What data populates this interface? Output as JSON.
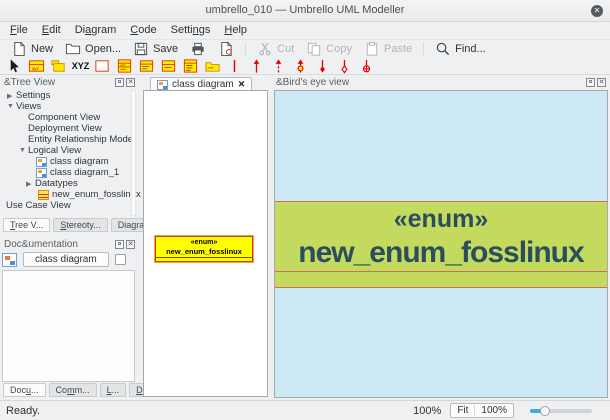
{
  "titlebar": {
    "title": "umbrello_010 — Umbrello UML Modeller"
  },
  "icons": {
    "window_close": "✕",
    "panel_close": "✕",
    "tab_close": "✕",
    "collapsed": "▶",
    "expanded": "▼",
    "object_letters": "xyz"
  },
  "menubar": {
    "items": [
      {
        "pre": "",
        "key": "F",
        "post": "ile"
      },
      {
        "pre": "",
        "key": "E",
        "post": "dit"
      },
      {
        "pre": "Di",
        "key": "a",
        "post": "gram"
      },
      {
        "pre": "",
        "key": "C",
        "post": "ode"
      },
      {
        "pre": "Setti",
        "key": "n",
        "post": "gs"
      },
      {
        "pre": "",
        "key": "H",
        "post": "elp"
      }
    ]
  },
  "toolbar": {
    "new_label": "New",
    "open_label": "Open...",
    "save_label": "Save",
    "cut_label": "Cut",
    "copy_label": "Copy",
    "paste_label": "Paste",
    "find_label": "Find..."
  },
  "work_toolbar": {
    "text_tool_label": "XYZ"
  },
  "tree_panel": {
    "header": "&Tree View",
    "items": [
      {
        "label": "Settings",
        "indent": 5,
        "expander": "collapsed"
      },
      {
        "label": "Views",
        "indent": 5,
        "expander": "expanded"
      },
      {
        "label": "Component View",
        "indent": 26
      },
      {
        "label": "Deployment View",
        "indent": 26
      },
      {
        "label": "Entity Relationship Model",
        "indent": 26
      },
      {
        "label": "Logical View",
        "indent": 17,
        "expander": "expanded"
      },
      {
        "label": "class diagram",
        "indent": 34,
        "icon": "diagram"
      },
      {
        "label": "class diagram_1",
        "indent": 34,
        "icon": "diagram"
      },
      {
        "label": "Datatypes",
        "indent": 24,
        "expander": "collapsed"
      },
      {
        "label": "new_enum_fosslinux",
        "indent": 36,
        "icon": "enum"
      },
      {
        "label": "Use Case View",
        "indent": 4
      }
    ]
  },
  "tree_tabs": {
    "items": [
      {
        "pre": "",
        "key": "T",
        "post": "ree V...",
        "active": true
      },
      {
        "pre": "",
        "key": "S",
        "post": "tereoty...",
        "active": false
      },
      {
        "pre": "Diagra...",
        "key": "",
        "post": "",
        "active": false
      }
    ]
  },
  "doc_panel": {
    "header": "Doc&umentation",
    "button_label": "class diagram"
  },
  "bottom_tabs": {
    "items": [
      {
        "pre": "Doc",
        "key": "u",
        "post": "...",
        "active": true
      },
      {
        "pre": "Co",
        "key": "m",
        "post": "m...",
        "active": false
      },
      {
        "pre": "",
        "key": "L",
        "post": "...",
        "active": false
      },
      {
        "pre": "",
        "key": "D",
        "post": "...",
        "active": false
      }
    ]
  },
  "diagram_tab": {
    "label": "class diagram"
  },
  "enum_widget": {
    "stereotype": "«enum»",
    "name": "new_enum_fosslinux"
  },
  "birdseye": {
    "header": "&Bird's eye view",
    "stereotype": "«enum»",
    "name": "new_enum_fosslinux"
  },
  "statusbar": {
    "message": "Ready.",
    "zoom_value": "100%",
    "fit_label": "Fit",
    "zoom_preset": "100%"
  },
  "colors": {
    "accent": "#3daee9",
    "tool_red": "#e60000",
    "widget_yellow": "#ffff00",
    "widget_border": "#d13a10",
    "band_green": "#c3da5e",
    "band_text": "#2b4d5f",
    "canvas_blue": "#cde9f6"
  }
}
